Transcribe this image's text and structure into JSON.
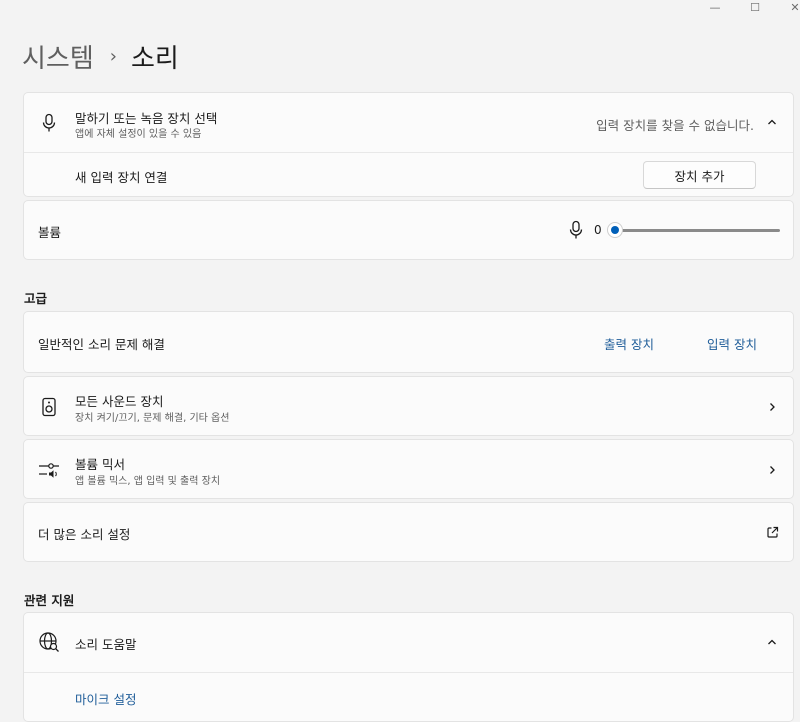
{
  "window": {
    "minimize_label": "—",
    "maximize_label": "☐",
    "close_label": "✕"
  },
  "breadcrumb": {
    "parent": "시스템",
    "separator": "›",
    "current": "소리"
  },
  "input_select": {
    "title": "말하기 또는 녹음 장치 선택",
    "subtitle": "앱에 자체 설정이 있을 수 있음",
    "status": "입력 장치를 찾을 수 없습니다.",
    "icon": "microphone-icon"
  },
  "new_device": {
    "label": "새 입력 장치 연결",
    "button": "장치 추가"
  },
  "volume": {
    "label": "볼륨",
    "value": "0",
    "level": 0
  },
  "advanced": {
    "heading": "고급",
    "troubleshoot": {
      "label": "일반적인 소리 문제 해결",
      "output_link": "출력 장치",
      "input_link": "입력 장치"
    },
    "all_devices": {
      "title": "모든 사운드 장치",
      "subtitle": "장치 켜기/끄기, 문제 해결, 기타 옵션",
      "icon": "speaker-icon"
    },
    "mixer": {
      "title": "볼륨 믹서",
      "subtitle": "앱 볼륨 믹스, 앱 입력 및 출력 장치",
      "icon": "volume-mixer-icon"
    },
    "more_settings": {
      "label": "더 많은 소리 설정"
    }
  },
  "related": {
    "heading": "관련 지원",
    "help": {
      "title": "소리 도움말",
      "icon": "globe-search-icon",
      "link": "마이크 설정"
    }
  },
  "colors": {
    "accent": "#005fb8",
    "link": "#1f5d99",
    "background": "#f3f3f3",
    "card": "#fbfbfb"
  }
}
